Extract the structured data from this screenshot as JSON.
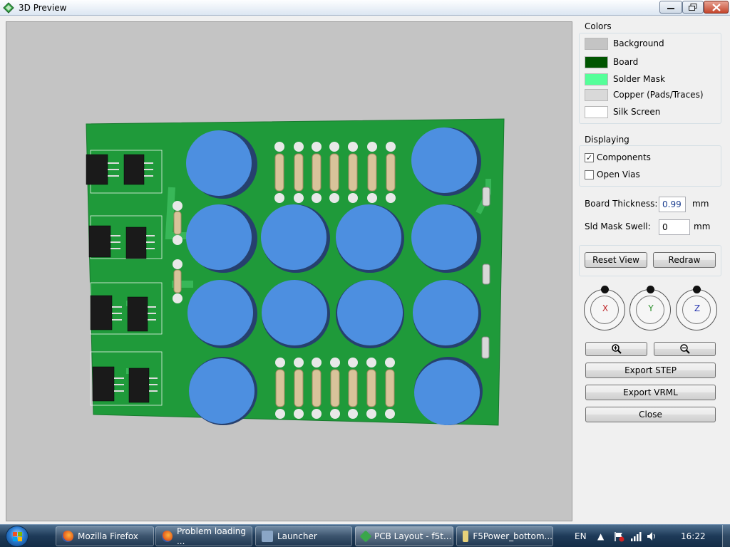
{
  "window": {
    "title": "3D Preview"
  },
  "colors": {
    "group_title": "Colors",
    "items": [
      {
        "label": "Background",
        "hex": "#c4c4c4"
      },
      {
        "label": "Board",
        "hex": "#005500"
      },
      {
        "label": "Solder Mask",
        "hex": "#55ff99"
      },
      {
        "label": "Copper (Pads/Traces)",
        "hex": "#d9d9d9"
      },
      {
        "label": "Silk Screen",
        "hex": "#ffffff"
      }
    ]
  },
  "displaying": {
    "group_title": "Displaying",
    "components": {
      "label": "Components",
      "checked": true
    },
    "open_vias": {
      "label": "Open Vias",
      "checked": false
    }
  },
  "board": {
    "thickness_label": "Board Thickness:",
    "thickness_value": "0.991",
    "thickness_unit": "mm",
    "swell_label": "Sld Mask Swell:",
    "swell_value": "0",
    "swell_unit": "mm"
  },
  "buttons": {
    "reset_view": "Reset View",
    "redraw": "Redraw",
    "export_step": "Export STEP",
    "export_vrml": "Export VRML",
    "close": "Close"
  },
  "dials": {
    "x": "X",
    "y": "Y",
    "z": "Z"
  },
  "taskbar": {
    "items": [
      "Mozilla Firefox",
      "Problem loading ...",
      "Launcher",
      "PCB Layout - f5t...",
      "F5Power_bottom..."
    ],
    "language": "EN",
    "clock": "16:22"
  }
}
